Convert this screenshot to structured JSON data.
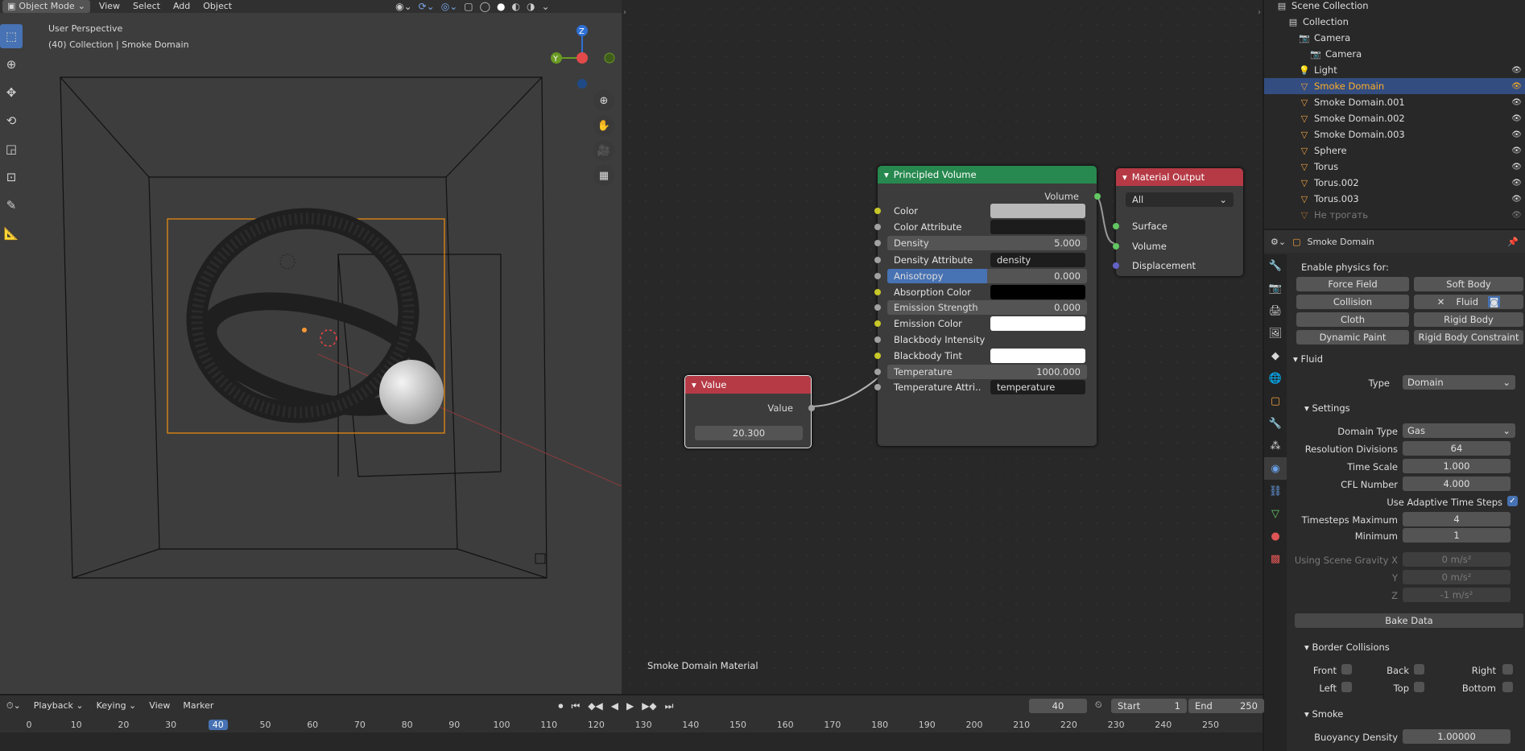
{
  "viewport": {
    "header": {
      "mode": "Object Mode",
      "menus": [
        "View",
        "Select",
        "Add",
        "Object"
      ]
    },
    "overlay": {
      "perspective": "User Perspective",
      "collection": "(40) Collection | Smoke Domain"
    },
    "gizmo": {
      "z": "Z",
      "y": "Y"
    }
  },
  "node_editor": {
    "material_name": "Smoke Domain Material",
    "principled": {
      "title": "Principled Volume",
      "output": "Volume",
      "inputs": [
        {
          "label": "Color",
          "type": "color",
          "color": "#b9b9b9",
          "socket": "y"
        },
        {
          "label": "Color Attribute",
          "type": "color",
          "color": "#1c1c1c",
          "socket": "g"
        },
        {
          "label": "Density",
          "type": "number",
          "value": "5.000",
          "socket": "g"
        },
        {
          "label": "Density Attribute",
          "type": "text",
          "value": "density",
          "socket": "g"
        },
        {
          "label": "Anisotropy",
          "type": "slider",
          "value": "0.000",
          "fill": 0.5,
          "socket": "g"
        },
        {
          "label": "Absorption Color",
          "type": "color",
          "color": "#000000",
          "socket": "y"
        },
        {
          "label": "Emission Strength",
          "type": "number",
          "value": "0.000",
          "socket": "g"
        },
        {
          "label": "Emission Color",
          "type": "color",
          "color": "#ffffff",
          "socket": "y"
        },
        {
          "label": "Blackbody Intensity",
          "type": "none",
          "socket": "g"
        },
        {
          "label": "Blackbody Tint",
          "type": "color",
          "color": "#ffffff",
          "socket": "y"
        },
        {
          "label": "Temperature",
          "type": "number",
          "value": "1000.000",
          "socket": "g"
        },
        {
          "label": "Temperature Attri..",
          "type": "text",
          "value": "temperature",
          "socket": "g"
        }
      ]
    },
    "value_node": {
      "title": "Value",
      "output": "Value",
      "value": "20.300"
    },
    "material_output": {
      "title": "Material Output",
      "target": "All",
      "inputs": [
        "Surface",
        "Volume",
        "Displacement"
      ]
    }
  },
  "outliner": {
    "items": [
      {
        "label": "Scene Collection",
        "indent": 1
      },
      {
        "label": "Collection",
        "indent": 2
      },
      {
        "label": "Camera",
        "indent": 3
      },
      {
        "label": "Camera",
        "indent": 4
      },
      {
        "label": "Light",
        "indent": 3
      },
      {
        "label": "Smoke Domain",
        "indent": 3,
        "selected": true
      },
      {
        "label": "Smoke Domain.001",
        "indent": 3
      },
      {
        "label": "Smoke Domain.002",
        "indent": 3
      },
      {
        "label": "Smoke Domain.003",
        "indent": 3
      },
      {
        "label": "Sphere",
        "indent": 3
      },
      {
        "label": "Torus",
        "indent": 3
      },
      {
        "label": "Torus.002",
        "indent": 3
      },
      {
        "label": "Torus.003",
        "indent": 3
      },
      {
        "label": "Не трогать",
        "indent": 3,
        "dim": true
      }
    ]
  },
  "properties": {
    "object_name": "Smoke Domain",
    "enable_physics": "Enable physics for:",
    "physics_buttons": [
      "Force Field",
      "Soft Body",
      "Collision",
      "Fluid",
      "Cloth",
      "Rigid Body",
      "Dynamic Paint",
      "Rigid Body Constraint"
    ],
    "fluid": {
      "title": "Fluid",
      "type_label": "Type",
      "type_value": "Domain"
    },
    "settings": {
      "title": "Settings",
      "domain_type_label": "Domain Type",
      "domain_type": "Gas",
      "resolution_label": "Resolution Divisions",
      "resolution": "64",
      "time_scale_label": "Time Scale",
      "time_scale": "1.000",
      "cfl_label": "CFL Number",
      "cfl": "4.000",
      "adaptive_label": "Use Adaptive Time Steps",
      "ts_max_label": "Timesteps Maximum",
      "ts_max": "4",
      "ts_min_label": "Minimum",
      "ts_min": "1",
      "gravity_label": "Using Scene Gravity X",
      "gx": "0 m/s²",
      "gy_label": "Y",
      "gy": "0 m/s²",
      "gz_label": "Z",
      "gz": "-1 m/s²",
      "bake": "Bake Data"
    },
    "border": {
      "title": "Border Collisions",
      "front": "Front",
      "back": "Back",
      "right": "Right",
      "left": "Left",
      "top": "Top",
      "bottom": "Bottom"
    },
    "smoke": {
      "title": "Smoke",
      "buoyancy_label": "Buoyancy Density",
      "buoyancy": "1.00000"
    }
  },
  "timeline": {
    "menus": [
      "Playback",
      "Keying",
      "View",
      "Marker"
    ],
    "current_frame": "40",
    "start_label": "Start",
    "start": "1",
    "end_label": "End",
    "end": "250",
    "ticks": [
      "0",
      "10",
      "20",
      "30",
      "40",
      "50",
      "60",
      "70",
      "80",
      "90",
      "100",
      "110",
      "120",
      "130",
      "140",
      "150",
      "160",
      "170",
      "180",
      "190",
      "200",
      "210",
      "220",
      "230",
      "240",
      "250"
    ]
  }
}
